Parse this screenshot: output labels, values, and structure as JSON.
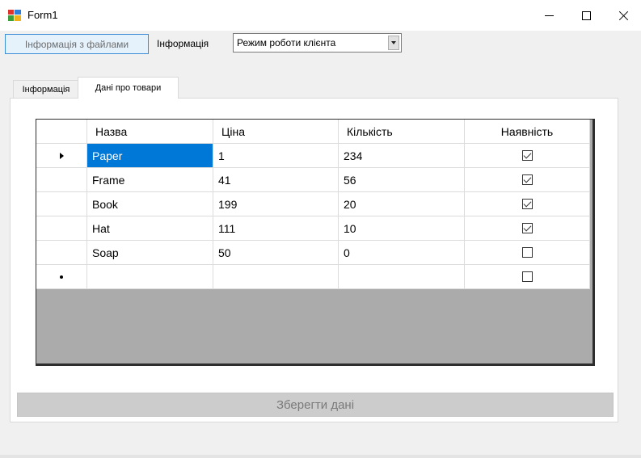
{
  "window": {
    "title": "Form1"
  },
  "toolbar": {
    "files_button": "Інформація з файлами",
    "info_label": "Інформація",
    "mode_select_value": "Режим роботи клієнта"
  },
  "tabs": [
    {
      "label": "Інформація",
      "active": false
    },
    {
      "label": "Дані про товари",
      "active": true
    }
  ],
  "grid": {
    "columns": [
      "Назва",
      "Ціна",
      "Кількість",
      "Наявність"
    ],
    "rows": [
      {
        "name": "Paper",
        "price": "1",
        "qty": "234",
        "available": true
      },
      {
        "name": "Frame",
        "price": "41",
        "qty": "56",
        "available": true
      },
      {
        "name": "Book",
        "price": "199",
        "qty": "20",
        "available": true
      },
      {
        "name": "Hat",
        "price": "111",
        "qty": "10",
        "available": true
      },
      {
        "name": "Soap",
        "price": "50",
        "qty": "0",
        "available": false
      }
    ],
    "new_row": {
      "name": "",
      "price": "",
      "qty": "",
      "available": false
    },
    "selected_row": 0
  },
  "save_button": "Зберегти дані",
  "colors": {
    "selection": "#0078d7",
    "grid_background": "#ababab",
    "button_border": "#3c8dd6"
  }
}
